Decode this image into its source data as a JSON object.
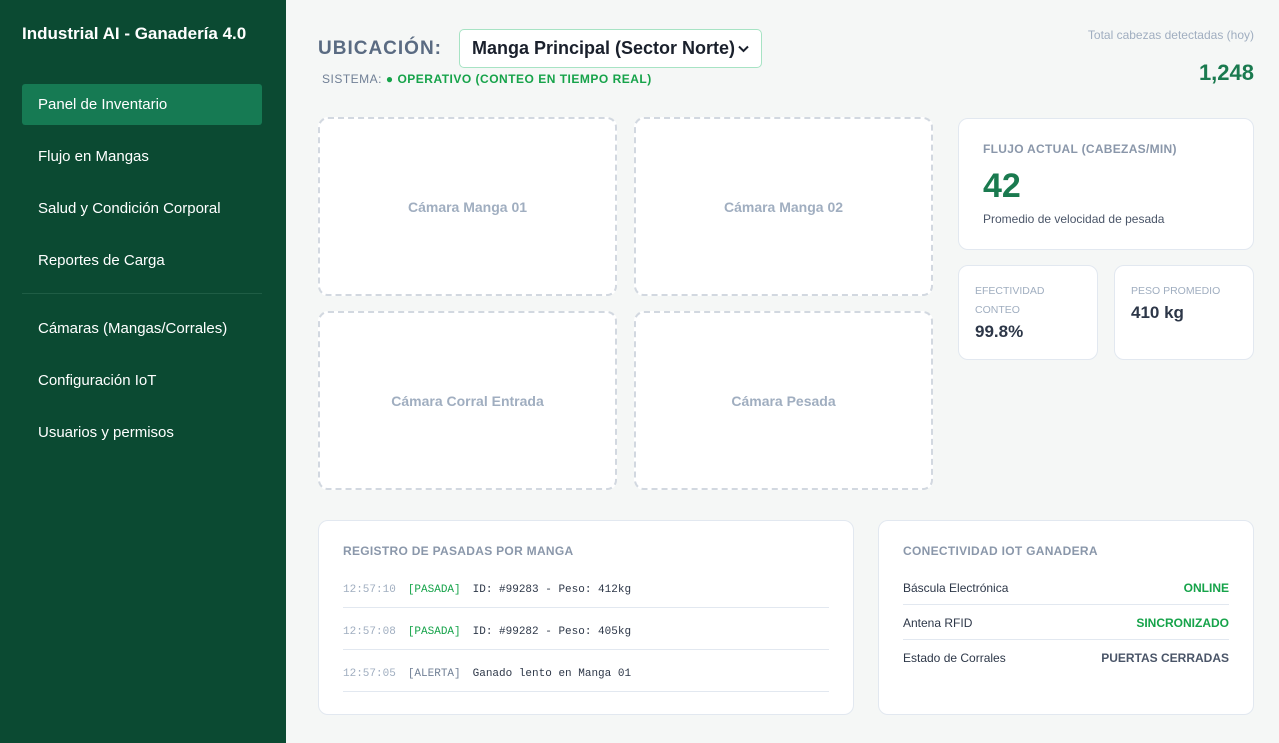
{
  "app": {
    "brand": "Industrial AI - Ganadería 4.0"
  },
  "sidebar": {
    "items": [
      {
        "label": "Panel de Inventario",
        "active": true
      },
      {
        "label": "Flujo en Mangas"
      },
      {
        "label": "Salud y Condición Corporal"
      },
      {
        "label": "Reportes de Carga"
      },
      {
        "label": "Cámaras (Mangas/Corrales)"
      },
      {
        "label": "Configuración IoT"
      },
      {
        "label": "Usuarios y permisos"
      }
    ]
  },
  "header": {
    "location_label": "UBICACIÓN:",
    "location_selected": "Manga Principal (Sector Norte)",
    "system_prefix": "SISTEMA:",
    "system_status": "● OPERATIVO (CONTEO EN TIEMPO REAL)",
    "total_label": "Total cabezas detectadas (hoy)",
    "total_value": "1,248"
  },
  "cameras": [
    "Cámara Manga 01",
    "Cámara Manga 02",
    "Cámara Corral Entrada",
    "Cámara Pesada"
  ],
  "metrics": {
    "flow_title": "FLUJO ACTUAL (CABEZAS/MIN)",
    "flow_value": "42",
    "flow_sub": "Promedio de velocidad de pesada",
    "effectiveness_title": "EFECTIVIDAD CONTEO",
    "effectiveness_value": "99.8%",
    "weight_title": "PESO PROMEDIO",
    "weight_value": "410 kg"
  },
  "log": {
    "title": "REGISTRO DE PASADAS POR MANGA",
    "entries": [
      {
        "time": "12:57:10",
        "tag": "[PASADA]",
        "text": "ID: #99283 - Peso: 412kg"
      },
      {
        "time": "12:57:08",
        "tag": "[PASADA]",
        "text": "ID: #99282 - Peso: 405kg"
      },
      {
        "time": "12:57:05",
        "tag": "[ALERTA]",
        "text": "Ganado lento en Manga 01"
      }
    ]
  },
  "iot": {
    "title": "CONECTIVIDAD IOT GANADERA",
    "rows": [
      {
        "label": "Báscula Electrónica",
        "value": "ONLINE",
        "color": "#16a34a"
      },
      {
        "label": "Antena RFID",
        "value": "SINCRONIZADO",
        "color": "#16a34a"
      },
      {
        "label": "Estado de Corrales",
        "value": "PUERTAS CERRADAS",
        "color": "#4a5568"
      }
    ]
  }
}
